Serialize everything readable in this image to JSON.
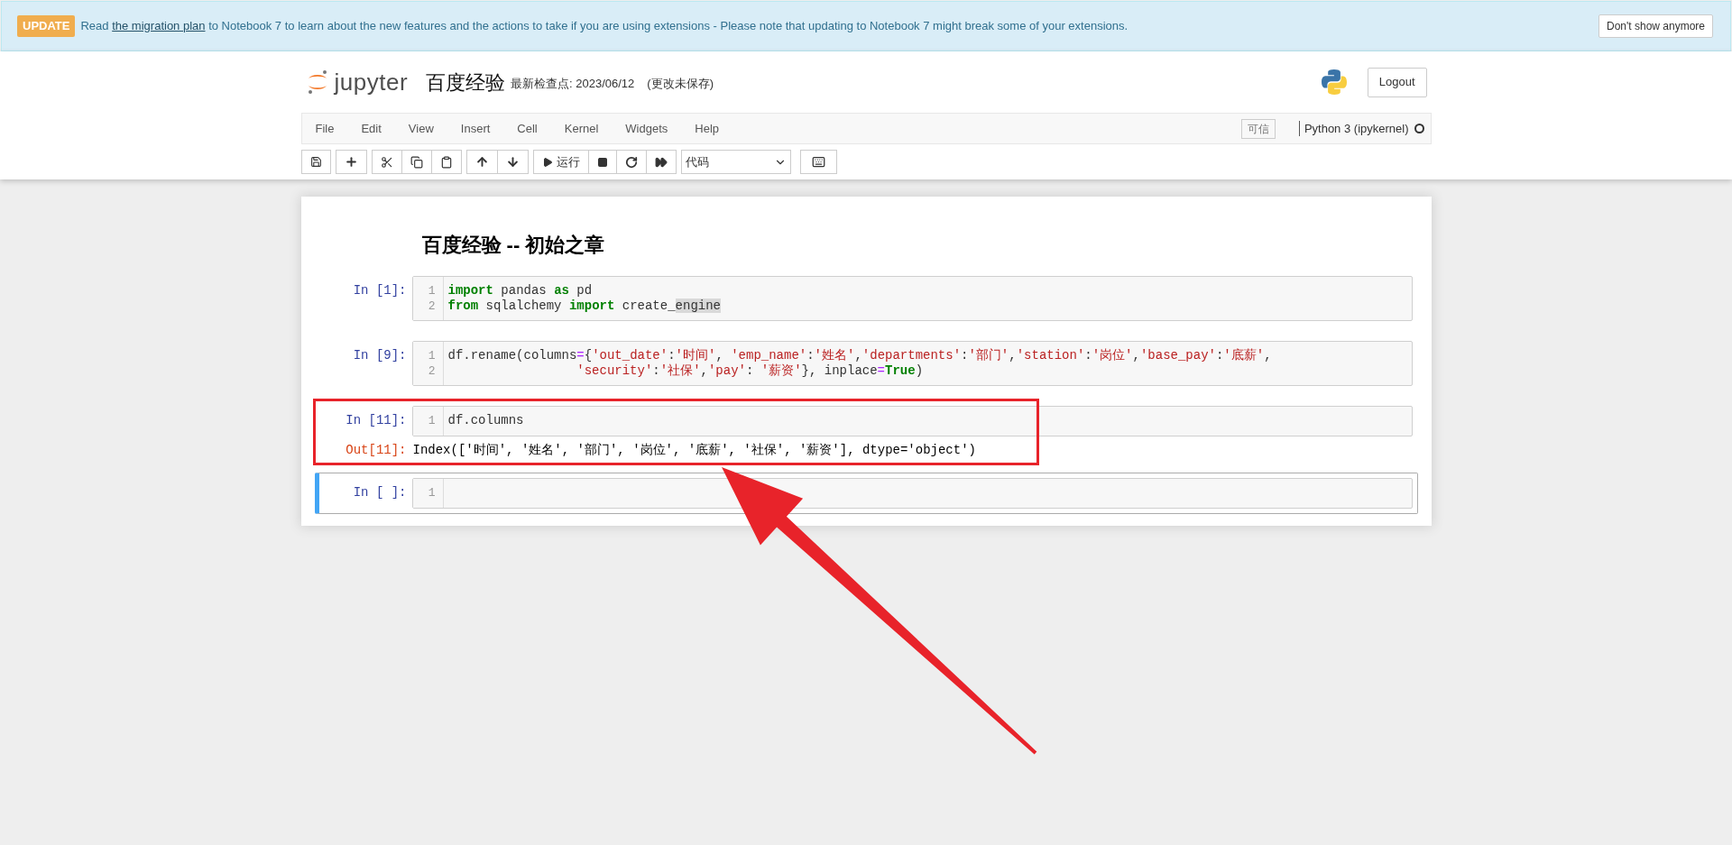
{
  "banner": {
    "badge": "UPDATE",
    "text_before": "Read",
    "link": "the migration plan",
    "text_after": "to Notebook 7 to learn about the new features and the actions to take if you are using extensions - Please note that updating to Notebook 7 might break some of your extensions.",
    "dismiss": "Don't show anymore"
  },
  "header": {
    "brand": "jupyter",
    "notebook_name": "百度经验",
    "checkpoint": "最新检查点: 2023/06/12",
    "save_status": "(更改未保存)",
    "logout": "Logout"
  },
  "menu": [
    "File",
    "Edit",
    "View",
    "Insert",
    "Cell",
    "Kernel",
    "Widgets",
    "Help"
  ],
  "kernel": {
    "trusted": "可信",
    "name": "Python 3 (ipykernel)",
    "busy": false
  },
  "toolbar": {
    "run_label": "运行",
    "cell_type": "代码"
  },
  "notebook": {
    "title": "百度经验 -- 初始之章",
    "cells": [
      {
        "prompt": "In [1]:",
        "selected": false,
        "highlighted": false,
        "lines": [
          {
            "number": "1",
            "continuation": false,
            "tokens": [
              {
                "kind": "keyword",
                "text": "import"
              },
              {
                "kind": "plain",
                "text": " pandas "
              },
              {
                "kind": "keyword",
                "text": "as"
              },
              {
                "kind": "plain",
                "text": " pd"
              }
            ]
          },
          {
            "number": "2",
            "continuation": false,
            "tokens": [
              {
                "kind": "keyword",
                "text": "from"
              },
              {
                "kind": "plain",
                "text": " sqlalchemy "
              },
              {
                "kind": "keyword",
                "text": "import"
              },
              {
                "kind": "plain",
                "text": " create_"
              },
              {
                "kind": "highlight",
                "text": "engine"
              }
            ]
          }
        ]
      },
      {
        "prompt": "In [9]:",
        "selected": false,
        "highlighted": false,
        "lines": [
          {
            "number": "1",
            "continuation": false,
            "tokens": [
              {
                "kind": "plain",
                "text": "df.rename(columns"
              },
              {
                "kind": "operator",
                "text": "="
              },
              {
                "kind": "plain",
                "text": "{"
              },
              {
                "kind": "string",
                "text": "'out_date'"
              },
              {
                "kind": "plain",
                "text": ":"
              },
              {
                "kind": "string",
                "text": "'时间'"
              },
              {
                "kind": "plain",
                "text": ", "
              },
              {
                "kind": "string",
                "text": "'emp_name'"
              },
              {
                "kind": "plain",
                "text": ":"
              },
              {
                "kind": "string",
                "text": "'姓名'"
              },
              {
                "kind": "plain",
                "text": ","
              },
              {
                "kind": "string",
                "text": "'departments'"
              },
              {
                "kind": "plain",
                "text": ":"
              },
              {
                "kind": "string",
                "text": "'部门'"
              },
              {
                "kind": "plain",
                "text": ","
              },
              {
                "kind": "string",
                "text": "'station'"
              },
              {
                "kind": "plain",
                "text": ":"
              },
              {
                "kind": "string",
                "text": "'岗位'"
              },
              {
                "kind": "plain",
                "text": ","
              },
              {
                "kind": "string",
                "text": "'base_pay'"
              },
              {
                "kind": "plain",
                "text": ":"
              },
              {
                "kind": "string",
                "text": "'底薪'"
              },
              {
                "kind": "plain",
                "text": ","
              }
            ]
          },
          {
            "number": "2",
            "continuation": true,
            "tokens": [
              {
                "kind": "string",
                "text": "'security'"
              },
              {
                "kind": "plain",
                "text": ":"
              },
              {
                "kind": "string",
                "text": "'社保'"
              },
              {
                "kind": "plain",
                "text": ","
              },
              {
                "kind": "string",
                "text": "'pay'"
              },
              {
                "kind": "plain",
                "text": ": "
              },
              {
                "kind": "string",
                "text": "'薪资'"
              },
              {
                "kind": "plain",
                "text": "}, inplace"
              },
              {
                "kind": "operator",
                "text": "="
              },
              {
                "kind": "keyword",
                "text": "True"
              },
              {
                "kind": "plain",
                "text": ")"
              }
            ]
          }
        ]
      },
      {
        "prompt": "In [11]:",
        "selected": false,
        "highlighted": true,
        "lines": [
          {
            "number": "1",
            "continuation": false,
            "tokens": [
              {
                "kind": "plain",
                "text": "df.columns"
              }
            ]
          }
        ],
        "output": {
          "prompt": "Out[11]:",
          "text": "Index(['时间', '姓名', '部门', '岗位', '底薪', '社保', '薪资'], dtype='object')"
        }
      },
      {
        "prompt": "In [ ]:",
        "selected": true,
        "highlighted": false,
        "lines": [
          {
            "number": "1"
          }
        ]
      }
    ]
  }
}
